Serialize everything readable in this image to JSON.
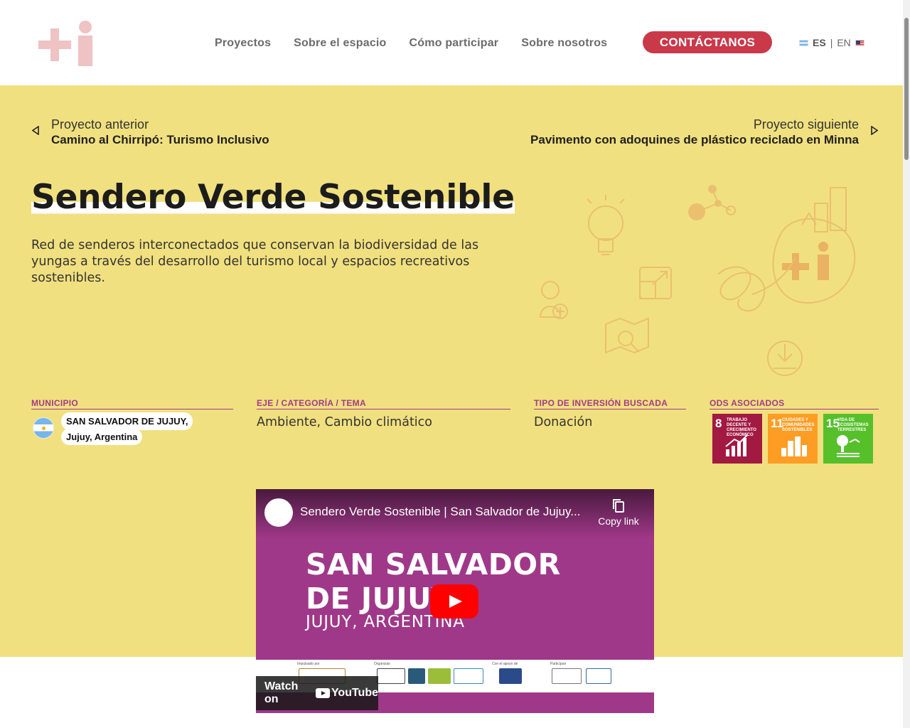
{
  "header": {
    "logo_alt": "+i",
    "nav": [
      "Proyectos",
      "Sobre el espacio",
      "Cómo participar",
      "Sobre nosotros"
    ],
    "cta": "CONTÁCTANOS",
    "lang": {
      "es": "ES",
      "sep": "|",
      "en": "EN"
    }
  },
  "project_nav": {
    "prev_label": "Proyecto anterior",
    "prev_title": "Camino al Chirripó: Turismo Inclusivo",
    "next_label": "Proyecto siguiente",
    "next_title": "Pavimento con adoquines de plástico reciclado en Minna"
  },
  "project": {
    "title": "Sendero Verde Sostenible",
    "description": "Red de senderos interconectados que conservan la biodiversidad de las yungas a través del desarrollo del turismo local y espacios recreativos sostenibles."
  },
  "meta": {
    "municipio_label": "MUNICIPIO",
    "municipio_line1": "SAN SALVADOR DE JUJUY,",
    "municipio_line2": "Jujuy, Argentina",
    "eje_label": "EJE / CATEGORÍA / TEMA",
    "eje_value": "Ambiente, Cambio climático",
    "tipo_label": "TIPO DE INVERSIÓN BUSCADA",
    "tipo_value": "Donación",
    "ods_label": "ODS ASOCIADOS",
    "ods": [
      {
        "num": "8",
        "text": "TRABAJO DECENTE Y CRECIMIENTO ECONÓMICO",
        "color": "#a21942"
      },
      {
        "num": "11",
        "text": "CIUDADES Y COMUNIDADES SOSTENIBLES",
        "color": "#fd9d24"
      },
      {
        "num": "15",
        "text": "VIDA DE ECOSISTEMAS TERRESTRES",
        "color": "#56c02b"
      }
    ]
  },
  "video": {
    "title": "Sendero Verde Sostenible | San Salvador de Jujuy...",
    "copy_link": "Copy link",
    "overlay_line1": "SAN SALVADOR",
    "overlay_line2": "DE JUJUY",
    "overlay_line3": "JUJUY, ARGENTINA",
    "watch_on": "Watch on",
    "youtube": "YouTube",
    "sponsor_labels": [
      "Impulsado por",
      "Organizan",
      "Con el apoyo de",
      "Participan"
    ]
  },
  "colors": {
    "hero_bg": "#f1e07f",
    "accent": "#c9394a",
    "meta_label": "#a23b8a"
  }
}
